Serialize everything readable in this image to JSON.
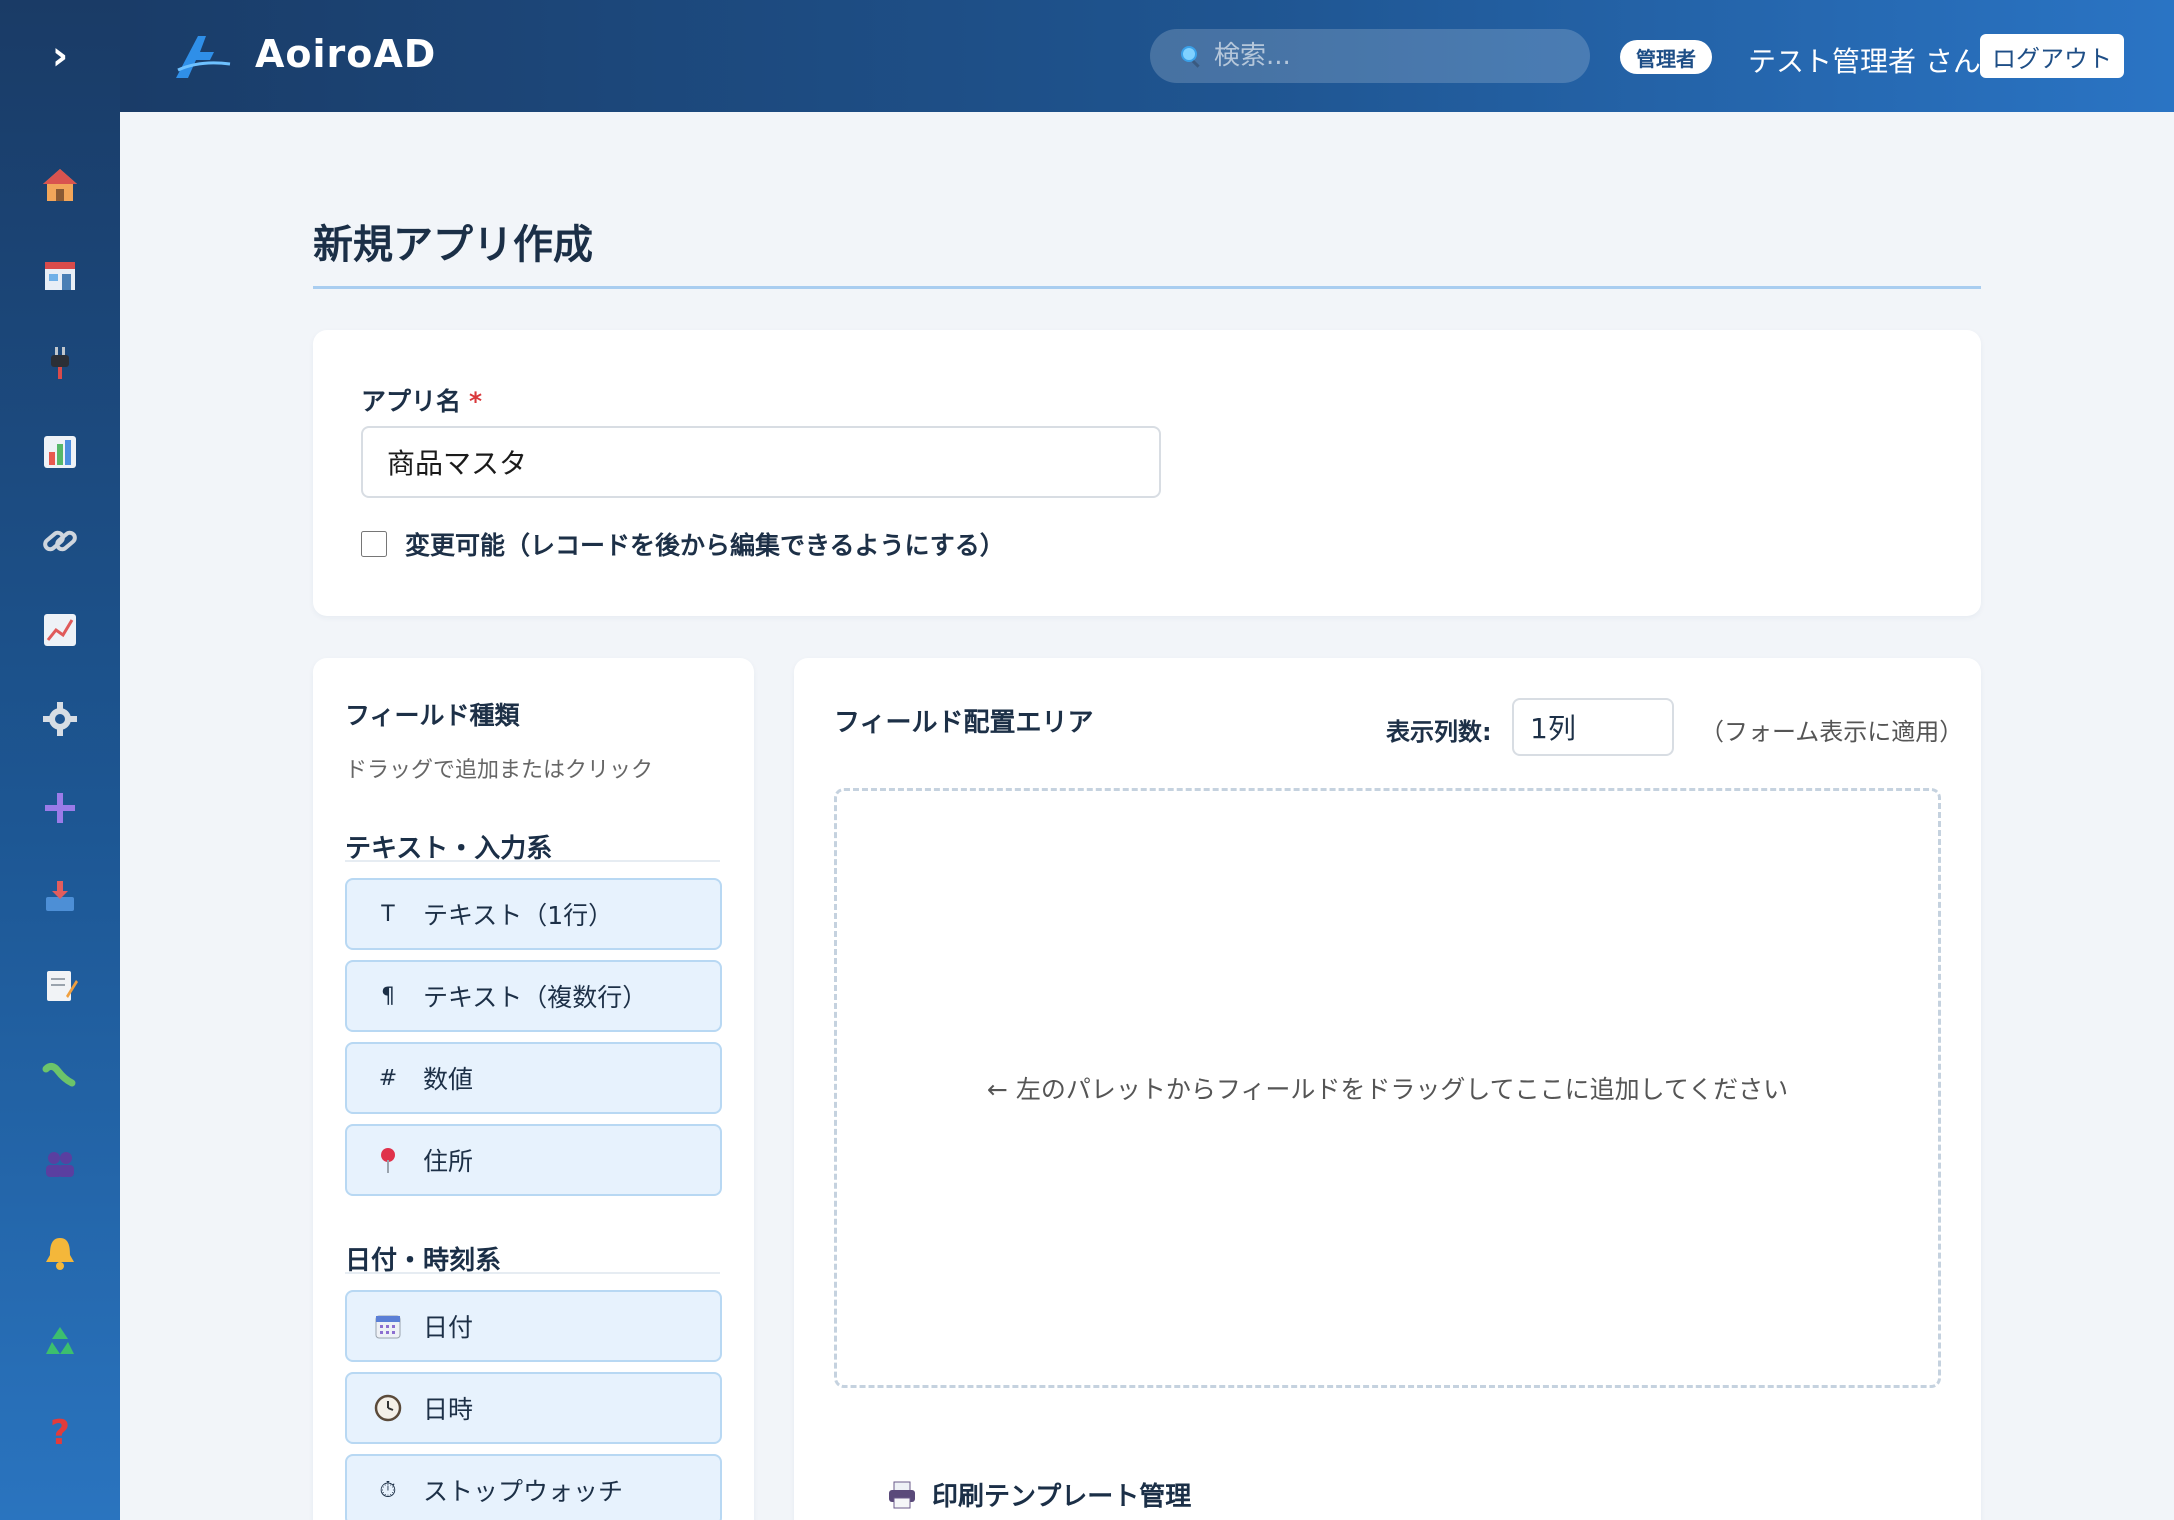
{
  "app": {
    "name": "AoiroAD"
  },
  "sidebar": {
    "toggle_label": "›",
    "items": [
      {
        "icon": "home-icon"
      },
      {
        "icon": "store-icon"
      },
      {
        "icon": "plug-icon"
      },
      {
        "icon": "bar-chart-icon"
      },
      {
        "icon": "link-icon"
      },
      {
        "icon": "line-chart-icon"
      },
      {
        "icon": "gear-icon"
      },
      {
        "icon": "plus-icon"
      },
      {
        "icon": "inbox-tray-icon"
      },
      {
        "icon": "memo-icon"
      },
      {
        "icon": "worm-icon"
      },
      {
        "icon": "users-icon"
      },
      {
        "icon": "bell-icon"
      },
      {
        "icon": "recycle-icon"
      },
      {
        "icon": "question-icon"
      }
    ]
  },
  "header": {
    "search_placeholder": "検索...",
    "role_badge": "管理者",
    "user_name": "テスト管理者 さん",
    "logout_label": "ログアウト"
  },
  "main": {
    "page_title": "新規アプリ作成",
    "app_name_label": "アプリ名",
    "required_mark": "*",
    "app_name_value": "商品マスタ",
    "editable_label": "変更可能（レコードを後から編集できるようにする）",
    "editable_checked": false,
    "palette": {
      "title": "フィールド種類",
      "hint": "ドラッグで追加またはクリック",
      "groups": [
        {
          "title": "テキスト・入力系",
          "fields": [
            {
              "icon": "T",
              "label": "テキスト（1行）"
            },
            {
              "icon": "¶",
              "label": "テキスト（複数行）"
            },
            {
              "icon": "#",
              "label": "数値"
            },
            {
              "icon": "pin-icon",
              "label": "住所"
            }
          ]
        },
        {
          "title": "日付・時刻系",
          "fields": [
            {
              "icon": "calendar-icon",
              "label": "日付"
            },
            {
              "icon": "clock-icon",
              "label": "日時"
            },
            {
              "icon": "⏱",
              "label": "ストップウォッチ"
            }
          ]
        }
      ]
    },
    "area": {
      "title": "フィールド配置エリア",
      "columns_label": "表示列数:",
      "columns_value": "1列",
      "columns_note": "（フォーム表示に適用）",
      "drop_hint": "← 左のパレットからフィールドをドラッグしてここに追加してください",
      "print_title": "印刷テンプレート管理"
    }
  },
  "colors": {
    "sidebar_top": "#1a3b66",
    "sidebar_bottom": "#2a74bf",
    "accent": "#1e4e86",
    "field_bg": "#e7f2fd",
    "field_border": "#b8d8f3",
    "required": "#d9383b"
  }
}
